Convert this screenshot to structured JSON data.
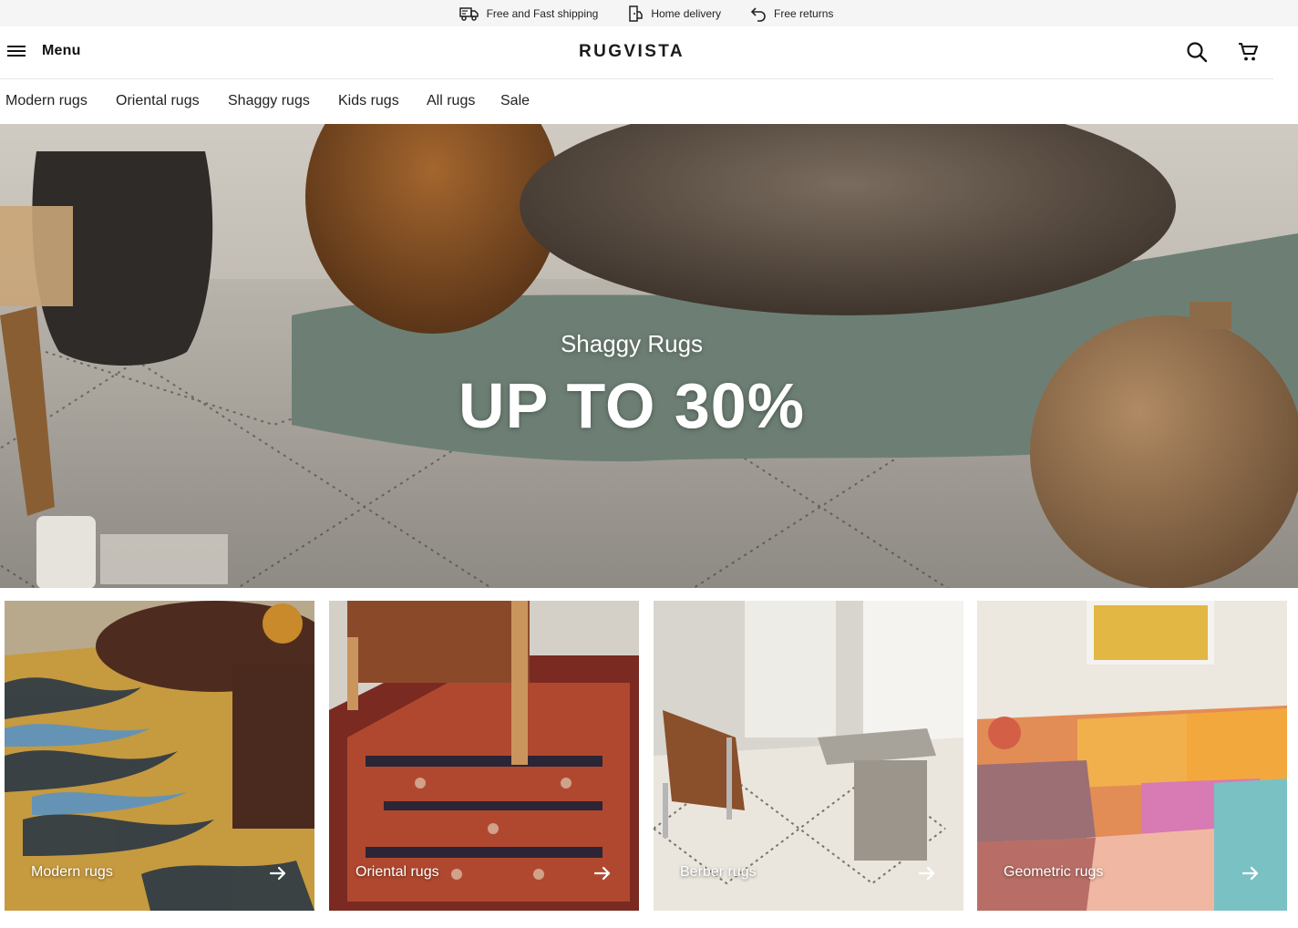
{
  "promo": {
    "items": [
      {
        "icon": "truck-icon",
        "label": "Free and Fast shipping"
      },
      {
        "icon": "home-delivery-icon",
        "label": "Home delivery"
      },
      {
        "icon": "return-arrow-icon",
        "label": "Free returns"
      }
    ]
  },
  "header": {
    "menu_label": "Menu",
    "logo": "RUGVISTA",
    "search_icon": "search-icon",
    "cart_icon": "cart-icon"
  },
  "nav": {
    "items": [
      "Modern rugs",
      "Oriental rugs",
      "Shaggy rugs",
      "Kids rugs",
      "All rugs",
      "Sale"
    ]
  },
  "hero": {
    "subtitle": "Shaggy Rugs",
    "title": "UP TO 30%"
  },
  "categories": [
    {
      "label": "Modern rugs",
      "icon": "arrow-right-icon"
    },
    {
      "label": "Oriental rugs",
      "icon": "arrow-right-icon"
    },
    {
      "label": "Berber rugs",
      "icon": "arrow-right-icon"
    },
    {
      "label": "Geometric rugs",
      "icon": "arrow-right-icon"
    }
  ]
}
